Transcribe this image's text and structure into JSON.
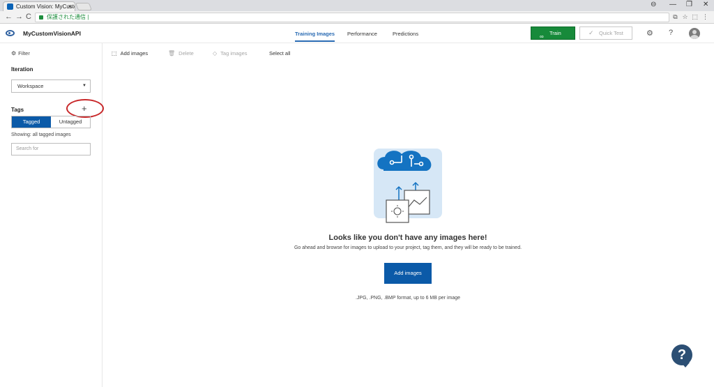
{
  "browser": {
    "tab_title": "Custom Vision: MyCustom",
    "tab_close": "×",
    "address_text": "保護された通信 |",
    "window_controls": [
      "⊖",
      "—",
      "❐",
      "✕"
    ],
    "nav": [
      "←",
      "→",
      "C"
    ],
    "extensions": [
      "⧉",
      "☆",
      "⬚",
      "⋮"
    ]
  },
  "header": {
    "project_name": "MyCustomVisionAPI",
    "tabs": [
      {
        "label": "Training Images",
        "active": true
      },
      {
        "label": "Performance",
        "active": false
      },
      {
        "label": "Predictions",
        "active": false
      }
    ],
    "train_label": "Train",
    "train_icon": "∞",
    "quick_test_label": "Quick Test",
    "quick_test_icon": "✓",
    "settings_icon": "⚙",
    "help_icon": "?"
  },
  "sidebar": {
    "filter_label": "Filter",
    "filter_icon": "⚙",
    "iteration_label": "Iteration",
    "iteration_value": "Workspace",
    "iteration_caret": "▼",
    "tags_label": "Tags",
    "add_tag_icon": "+",
    "toggle": {
      "tagged": "Tagged",
      "untagged": "Untagged"
    },
    "showing_text": "Showing: all tagged images",
    "search_placeholder": "Search for"
  },
  "toolbar": {
    "add_images": "Add images",
    "delete": "Delete",
    "tag_images": "Tag images",
    "select_all": "Select all"
  },
  "empty_state": {
    "heading": "Looks like you don't have any images here!",
    "subtext": "Go ahead and browse for images to upload to your project, tag them, and they will be ready to be trained.",
    "button_label": "Add images",
    "format_note": ".JPG, .PNG, .BMP format, up to 6 MB per image"
  },
  "help_button": "?",
  "colors": {
    "accent": "#0b5aa8",
    "train_green": "#178a3a",
    "highlight_red": "#c8282a"
  }
}
